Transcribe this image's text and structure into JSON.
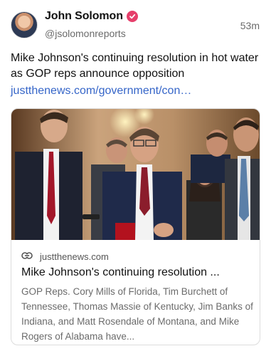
{
  "author": {
    "name": "John Solomon",
    "handle": "@jsolomonreports",
    "verified_color": "#e63f6b"
  },
  "post": {
    "time": "53m",
    "text": "Mike Johnson's continuing resolution in hot water as GOP reps announce opposition",
    "link": "justthenews.com/government/con…",
    "link_color": "#3565c8"
  },
  "card": {
    "domain": "justthenews.com",
    "title": "Mike Johnson's continuing resolution ...",
    "description": "GOP Reps. Cory Mills of Florida, Tim Burchett of Tennessee, Thomas Massie of Kentucky, Jim Banks of Indiana, and Matt Rosendale of Montana, and Mike Rogers of Alabama have..."
  },
  "icons": {
    "verified": "verified-badge-icon",
    "link": "link-icon"
  }
}
